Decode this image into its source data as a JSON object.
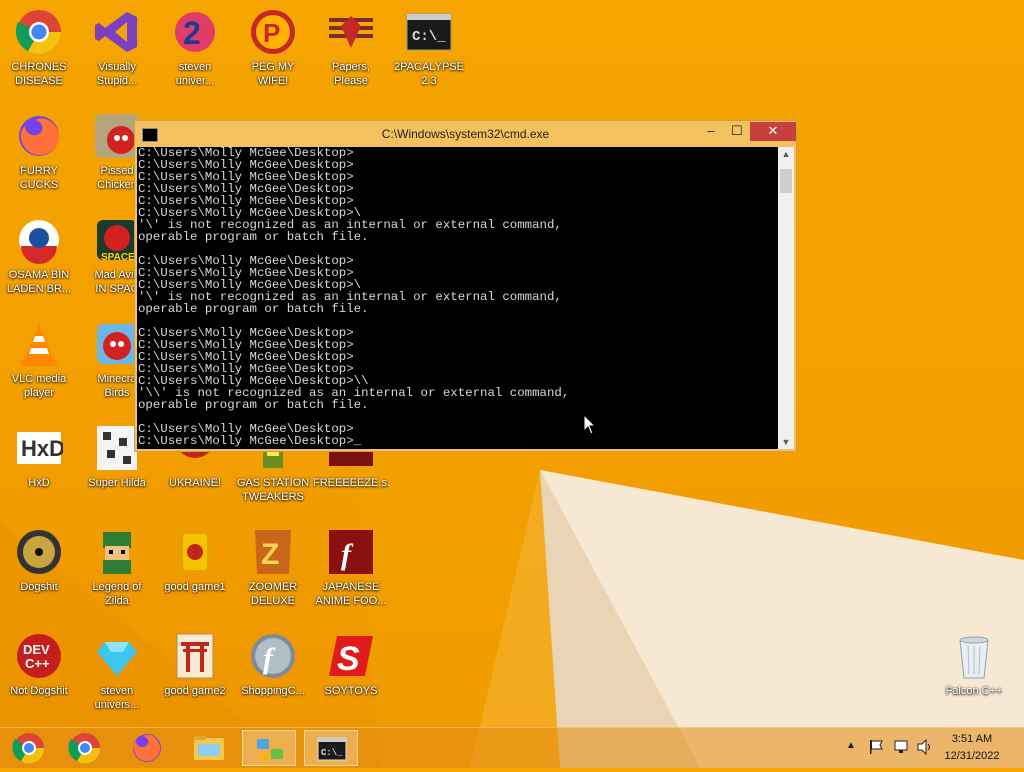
{
  "desktop_icons": [
    {
      "name": "chrome-desktop-icon",
      "label": "CHRONES\nDISEASE",
      "icon": "chrome-icon"
    },
    {
      "name": "visual-studio-desktop-icon",
      "label": "Visually\nStupid...",
      "icon": "visual-studio-icon"
    },
    {
      "name": "steven-universe-desktop-icon",
      "label": "steven\nuniver...",
      "icon": "steven-universe-icon"
    },
    {
      "name": "peg-my-wife-desktop-icon",
      "label": "PEG MY WIFE!",
      "icon": "peggle-icon"
    },
    {
      "name": "papers-please-desktop-icon",
      "label": "Papers,\nPlease",
      "icon": "papers-please-icon"
    },
    {
      "name": "2pacalypse-desktop-icon",
      "label": "2PACALYPSE\n2.3",
      "icon": "cmd-icon"
    },
    {
      "name": "firefox-desktop-icon",
      "label": "FURRY CUCKS",
      "icon": "firefox-icon"
    },
    {
      "name": "pissed-chicken-desktop-icon",
      "label": "Pissed\nChicken",
      "icon": "angry-birds-seasons-icon"
    },
    {
      "name": "osama-desktop-icon",
      "label": "OSAMA BIN\nLADEN BR...",
      "icon": "obama-logo-icon"
    },
    {
      "name": "mad-avian-desktop-icon",
      "label": "Mad Avia\nIN SPAC",
      "icon": "angry-birds-space-icon"
    },
    {
      "name": "vlc-desktop-icon",
      "label": "VLC media\nplayer",
      "icon": "vlc-icon"
    },
    {
      "name": "minecraft-birds-desktop-icon",
      "label": "Minecra\nBirds",
      "icon": "angry-birds-icon"
    },
    {
      "name": "hxd-desktop-icon",
      "label": "HxD",
      "icon": "hxd-icon"
    },
    {
      "name": "super-hilda-desktop-icon",
      "label": "Super Hilda",
      "icon": "pixel-game-icon"
    },
    {
      "name": "ukraine-desktop-icon",
      "label": "UKRAINE!",
      "icon": "red-circle-icon"
    },
    {
      "name": "gas-station-desktop-icon",
      "label": "GAS STATION\nTWEAKERS",
      "icon": "gas-station-icon"
    },
    {
      "name": "freeeeeze-desktop-icon",
      "label": "FREEEEEZE.s...",
      "icon": "flash-icon"
    },
    {
      "name": "dogshit-desktop-icon",
      "label": "Dogshit",
      "icon": "disc-icon"
    },
    {
      "name": "legend-of-zilda-desktop-icon",
      "label": "Legend of\nZilda",
      "icon": "zelda-icon"
    },
    {
      "name": "good-game1-desktop-icon",
      "label": "good game1",
      "icon": "mahjong-icon"
    },
    {
      "name": "zoomer-deluxe-desktop-icon",
      "label": "ZOOMER\nDELUXE",
      "icon": "zuma-icon"
    },
    {
      "name": "japanese-anime-desktop-icon",
      "label": "JAPANESE\nANIME FOO...",
      "icon": "flash-icon"
    },
    {
      "name": "not-dogshit-desktop-icon",
      "label": "Not Dogshit",
      "icon": "dev-cpp-icon"
    },
    {
      "name": "steven-univer2-desktop-icon",
      "label": "steven\nunivers...",
      "icon": "diamond-icon"
    },
    {
      "name": "good-game2-desktop-icon",
      "label": "good game2",
      "icon": "torii-icon"
    },
    {
      "name": "shopping-desktop-icon",
      "label": "ShoppingC...",
      "icon": "flash-player-icon"
    },
    {
      "name": "soytoys-desktop-icon",
      "label": "SOYTOYS",
      "icon": "s-logo-icon"
    },
    {
      "name": "recycle-bin-desktop-icon",
      "label": "Falcon C++",
      "icon": "recycle-bin-icon"
    }
  ],
  "cmd": {
    "title": "C:\\Windows\\system32\\cmd.exe",
    "minimize": "–",
    "maximize": "☐",
    "close": "✕",
    "lines": [
      "C:\\Users\\Molly McGee\\Desktop>",
      "C:\\Users\\Molly McGee\\Desktop>",
      "C:\\Users\\Molly McGee\\Desktop>",
      "C:\\Users\\Molly McGee\\Desktop>",
      "C:\\Users\\Molly McGee\\Desktop>",
      "C:\\Users\\Molly McGee\\Desktop>\\",
      "'\\' is not recognized as an internal or external command,",
      "operable program or batch file.",
      "",
      "C:\\Users\\Molly McGee\\Desktop>",
      "C:\\Users\\Molly McGee\\Desktop>",
      "C:\\Users\\Molly McGee\\Desktop>\\",
      "'\\' is not recognized as an internal or external command,",
      "operable program or batch file.",
      "",
      "C:\\Users\\Molly McGee\\Desktop>",
      "C:\\Users\\Molly McGee\\Desktop>",
      "C:\\Users\\Molly McGee\\Desktop>",
      "C:\\Users\\Molly McGee\\Desktop>",
      "C:\\Users\\Molly McGee\\Desktop>\\\\",
      "'\\\\' is not recognized as an internal or external command,",
      "operable program or batch file.",
      "",
      "C:\\Users\\Molly McGee\\Desktop>",
      "C:\\Users\\Molly McGee\\Desktop>_"
    ]
  },
  "taskbar": {
    "items": [
      {
        "name": "taskbar-chrome-alt",
        "icon": "chrome-icon"
      },
      {
        "name": "taskbar-chrome",
        "icon": "chrome-icon"
      },
      {
        "name": "taskbar-firefox",
        "icon": "firefox-icon"
      },
      {
        "name": "taskbar-file-explorer",
        "icon": "folder-icon"
      },
      {
        "name": "taskbar-network",
        "icon": "network-icon"
      },
      {
        "name": "taskbar-cmd",
        "icon": "cmd-icon",
        "active": true
      }
    ],
    "time": "3:51 AM",
    "date": "12/31/2022"
  },
  "colors": {
    "accent": "#f5a400",
    "close": "#c7403c"
  }
}
